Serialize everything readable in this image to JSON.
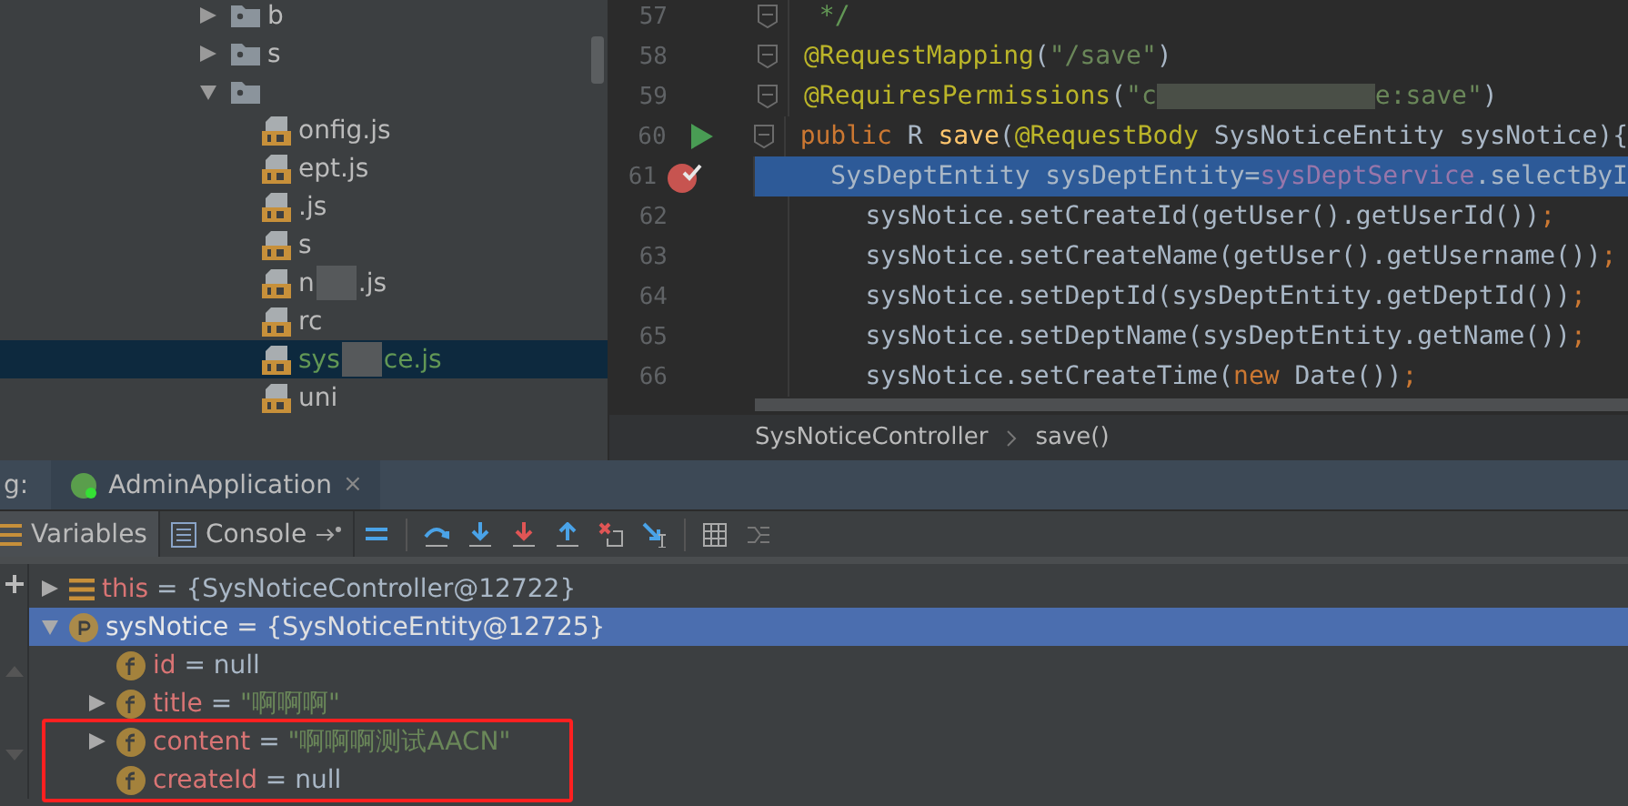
{
  "project_tree": {
    "items": [
      {
        "kind": "folder",
        "expanded": false,
        "parts": [
          "b"
        ],
        "selected": false
      },
      {
        "kind": "folder",
        "expanded": false,
        "parts": [
          "s"
        ],
        "selected": false
      },
      {
        "kind": "folder",
        "expanded": true,
        "selected": false
      },
      {
        "kind": "js",
        "parts": [
          "onfig.js"
        ],
        "selected": false
      },
      {
        "kind": "js",
        "parts": [
          "ept.js"
        ],
        "selected": false
      },
      {
        "kind": "js",
        "parts": [
          ".js"
        ],
        "selected": false
      },
      {
        "kind": "js",
        "parts": [
          "s"
        ],
        "selected": false
      },
      {
        "kind": "js",
        "parts": [
          "n",
          ".js"
        ],
        "selected": false
      },
      {
        "kind": "js",
        "parts": [
          "rc"
        ],
        "selected": false
      },
      {
        "kind": "js",
        "parts": [
          "sys",
          "ce.js"
        ],
        "selected": true
      },
      {
        "kind": "js",
        "parts": [
          "uni"
        ],
        "selected": false
      }
    ]
  },
  "editor": {
    "lines": [
      {
        "number": "57",
        "current": false,
        "foldable": true,
        "run_marker": false,
        "breakpoint": false,
        "segments": [
          {
            "kind": "comment",
            "text": " */"
          }
        ]
      },
      {
        "number": "58",
        "current": false,
        "foldable": true,
        "run_marker": false,
        "breakpoint": false,
        "segments": [
          {
            "kind": "annotation",
            "text": "@RequestMapping"
          },
          {
            "kind": "plain",
            "text": "("
          },
          {
            "kind": "string",
            "text": "\"/save\""
          },
          {
            "kind": "plain",
            "text": ")"
          }
        ]
      },
      {
        "number": "59",
        "current": false,
        "foldable": true,
        "run_marker": false,
        "breakpoint": false,
        "segments": [
          {
            "kind": "annotation",
            "text": "@RequiresPermissions"
          },
          {
            "kind": "plain",
            "text": "("
          },
          {
            "kind": "string",
            "text": "\"c"
          },
          {
            "kind": "redacted"
          },
          {
            "kind": "string",
            "text": "e:save\""
          },
          {
            "kind": "plain",
            "text": ")"
          }
        ]
      },
      {
        "number": "60",
        "current": false,
        "foldable": true,
        "run_marker": true,
        "breakpoint": false,
        "segments": [
          {
            "kind": "keyword",
            "text": "public "
          },
          {
            "kind": "plain",
            "text": "R "
          },
          {
            "kind": "method",
            "text": "save"
          },
          {
            "kind": "plain",
            "text": "("
          },
          {
            "kind": "annotation",
            "text": "@RequestBody "
          },
          {
            "kind": "plain",
            "text": "SysNoticeEntity sysNotice){"
          }
        ]
      },
      {
        "number": "61",
        "current": true,
        "foldable": false,
        "run_marker": false,
        "breakpoint": true,
        "segments": [
          {
            "kind": "plain",
            "text": "    SysDeptEntity sysDeptEntity="
          },
          {
            "kind": "field",
            "text": "sysDeptService"
          },
          {
            "kind": "plain",
            "text": ".selectByI"
          }
        ]
      },
      {
        "number": "62",
        "current": false,
        "foldable": false,
        "run_marker": false,
        "breakpoint": false,
        "segments": [
          {
            "kind": "plain",
            "text": "    sysNotice.setCreateId(getUser().getUserId())"
          },
          {
            "kind": "keyword",
            "text": ";"
          }
        ]
      },
      {
        "number": "63",
        "current": false,
        "foldable": false,
        "run_marker": false,
        "breakpoint": false,
        "segments": [
          {
            "kind": "plain",
            "text": "    sysNotice.setCreateName(getUser().getUsername())"
          },
          {
            "kind": "keyword",
            "text": ";"
          }
        ]
      },
      {
        "number": "64",
        "current": false,
        "foldable": false,
        "run_marker": false,
        "breakpoint": false,
        "segments": [
          {
            "kind": "plain",
            "text": "    sysNotice.setDeptId(sysDeptEntity.getDeptId())"
          },
          {
            "kind": "keyword",
            "text": ";"
          }
        ]
      },
      {
        "number": "65",
        "current": false,
        "foldable": false,
        "run_marker": false,
        "breakpoint": false,
        "segments": [
          {
            "kind": "plain",
            "text": "    sysNotice.setDeptName(sysDeptEntity.getName())"
          },
          {
            "kind": "keyword",
            "text": ";"
          }
        ]
      },
      {
        "number": "66",
        "current": false,
        "foldable": false,
        "run_marker": false,
        "breakpoint": false,
        "segments": [
          {
            "kind": "plain",
            "text": "    sysNotice.setCreateTime("
          },
          {
            "kind": "keyword",
            "text": "new "
          },
          {
            "kind": "plain",
            "text": "Date())"
          },
          {
            "kind": "keyword",
            "text": ";"
          }
        ]
      }
    ],
    "breadcrumb": [
      "SysNoticeController",
      "save()"
    ]
  },
  "debug": {
    "label": "g:",
    "session_tab": {
      "title": "AdminApplication",
      "close": "×"
    },
    "tabs": [
      {
        "label": "Variables",
        "selected": true
      },
      {
        "label": "Console",
        "selected": false
      }
    ],
    "variables": [
      {
        "kind": "object",
        "expanded": false,
        "selected": false,
        "name": "this",
        "separator": "=",
        "value": "{SysNoticeController@12722}",
        "value_is_string": false
      },
      {
        "kind": "param",
        "expanded": true,
        "selected": true,
        "name": "sysNotice",
        "separator": "=",
        "value": "{SysNoticeEntity@12725}",
        "value_is_string": false
      },
      {
        "kind": "field",
        "selected": false,
        "name": "id",
        "separator": "=",
        "value": "null",
        "value_is_string": false
      },
      {
        "kind": "field",
        "expanded": false,
        "selected": false,
        "name": "title",
        "separator": "=",
        "value": "\"啊啊啊\"",
        "value_is_string": true
      },
      {
        "kind": "field",
        "expanded": false,
        "selected": false,
        "name": "content",
        "separator": "=",
        "value": "\"啊啊啊测试AACN\"",
        "value_is_string": true,
        "highlighted": true
      },
      {
        "kind": "field",
        "selected": false,
        "name": "createId",
        "separator": "=",
        "value": "null",
        "value_is_string": false
      }
    ]
  }
}
